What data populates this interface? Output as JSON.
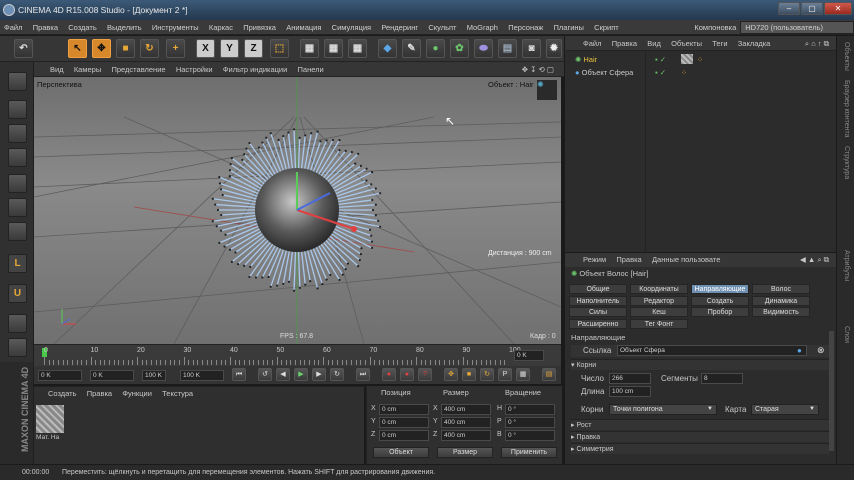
{
  "window": {
    "title": "CINEMA 4D R15.008 Studio - [Документ 2 *]",
    "buttons": [
      "–",
      "▢",
      "✕"
    ]
  },
  "menubar": {
    "items": [
      "Файл",
      "Правка",
      "Создать",
      "Выделить",
      "Инструменты",
      "Каркас",
      "Привязка",
      "Анимация",
      "Симуляция",
      "Рендеринг",
      "Скульпт",
      "MoGraph",
      "Персонаж",
      "Плагины",
      "Скрипт"
    ],
    "layout_label": "Компоновка",
    "layout_value": "HD720 (пользователь)"
  },
  "toolbar": {
    "axes": [
      "X",
      "Y",
      "Z"
    ]
  },
  "viewport": {
    "menu": [
      "Вид",
      "Камеры",
      "Представление",
      "Настройки",
      "Фильтр индикации",
      "Панели"
    ],
    "name": "Перспектива",
    "camera": "Объект : Hair",
    "distance": "Дистанция : 900 cm",
    "fps": "FPS : 67.8",
    "frame": "Кадр : 0"
  },
  "timeline": {
    "ticks": [
      "0",
      "10",
      "20",
      "30",
      "40",
      "50",
      "60",
      "70",
      "80",
      "90",
      "100"
    ],
    "end_field": "0 K"
  },
  "transport": {
    "start": "0 K",
    "preview_start": "0 K",
    "preview_end": "100 K",
    "end": "100 K"
  },
  "materials": {
    "menu": [
      "Создать",
      "Правка",
      "Функции",
      "Текстура"
    ],
    "swatch_label": "Мат. На"
  },
  "coords": {
    "headers": [
      "Позиция",
      "Размер",
      "Вращение"
    ],
    "rows": [
      {
        "axis": "X",
        "pos": "0 cm",
        "size_axis": "X",
        "size": "400 cm",
        "rot_axis": "H",
        "rot": "0 °"
      },
      {
        "axis": "Y",
        "pos": "0 cm",
        "size_axis": "Y",
        "size": "400 cm",
        "rot_axis": "P",
        "rot": "0 °"
      },
      {
        "axis": "Z",
        "pos": "0 cm",
        "size_axis": "Z",
        "size": "400 cm",
        "rot_axis": "B",
        "rot": "0 °"
      }
    ],
    "mode": "Объект",
    "size_mode": "Размер",
    "apply": "Применить"
  },
  "maxon": {
    "brand": "MAXON CINEMA 4D"
  },
  "status": {
    "time": "00:00:00",
    "hint": "Переместить: щёлкнуть и перетащить для перемещения элементов. Нажать SHIFT для растрирования движения."
  },
  "objects": {
    "menu": [
      "Файл",
      "Правка",
      "Вид",
      "Объекты",
      "Теги",
      "Закладка"
    ],
    "items": [
      {
        "name": "Hair"
      },
      {
        "name": "Объект Сфера"
      }
    ]
  },
  "attributes": {
    "menu": [
      "Режим",
      "Правка",
      "Данные пользовате"
    ],
    "object_title": "Объект Волос [Hair]",
    "tabs": [
      "Общие",
      "Координаты",
      "Направляющие",
      "Волос",
      "Наполнитель",
      "Редактор",
      "Создать",
      "Динамика",
      "Силы",
      "Кеш",
      "Пробор",
      "Видимость",
      "Расширенно",
      "Тег Фонт"
    ],
    "active_tab": "Направляющие",
    "section": "Направляющие",
    "link_label": "Ссылка",
    "link_value": "Объект Сфера",
    "roots_header": "Корни",
    "count_label": "Число",
    "count_value": "266",
    "segments_label": "Сегменты",
    "segments_value": "8",
    "length_label": "Длина",
    "length_value": "100 cm",
    "roots_label": "Корни",
    "roots_value": "Точки полигона",
    "map_label": "Карта",
    "map_value": "Старая",
    "groups": [
      "Рост",
      "Правка",
      "Симметрия"
    ]
  },
  "side_tabs": [
    "Объекты",
    "Браузер контента",
    "Структура",
    "Атрибуты",
    "Слои"
  ],
  "colors": {
    "accent": "#d7882a",
    "selected_tab": "#6f8fb0",
    "hair": "#a9c7ea"
  }
}
